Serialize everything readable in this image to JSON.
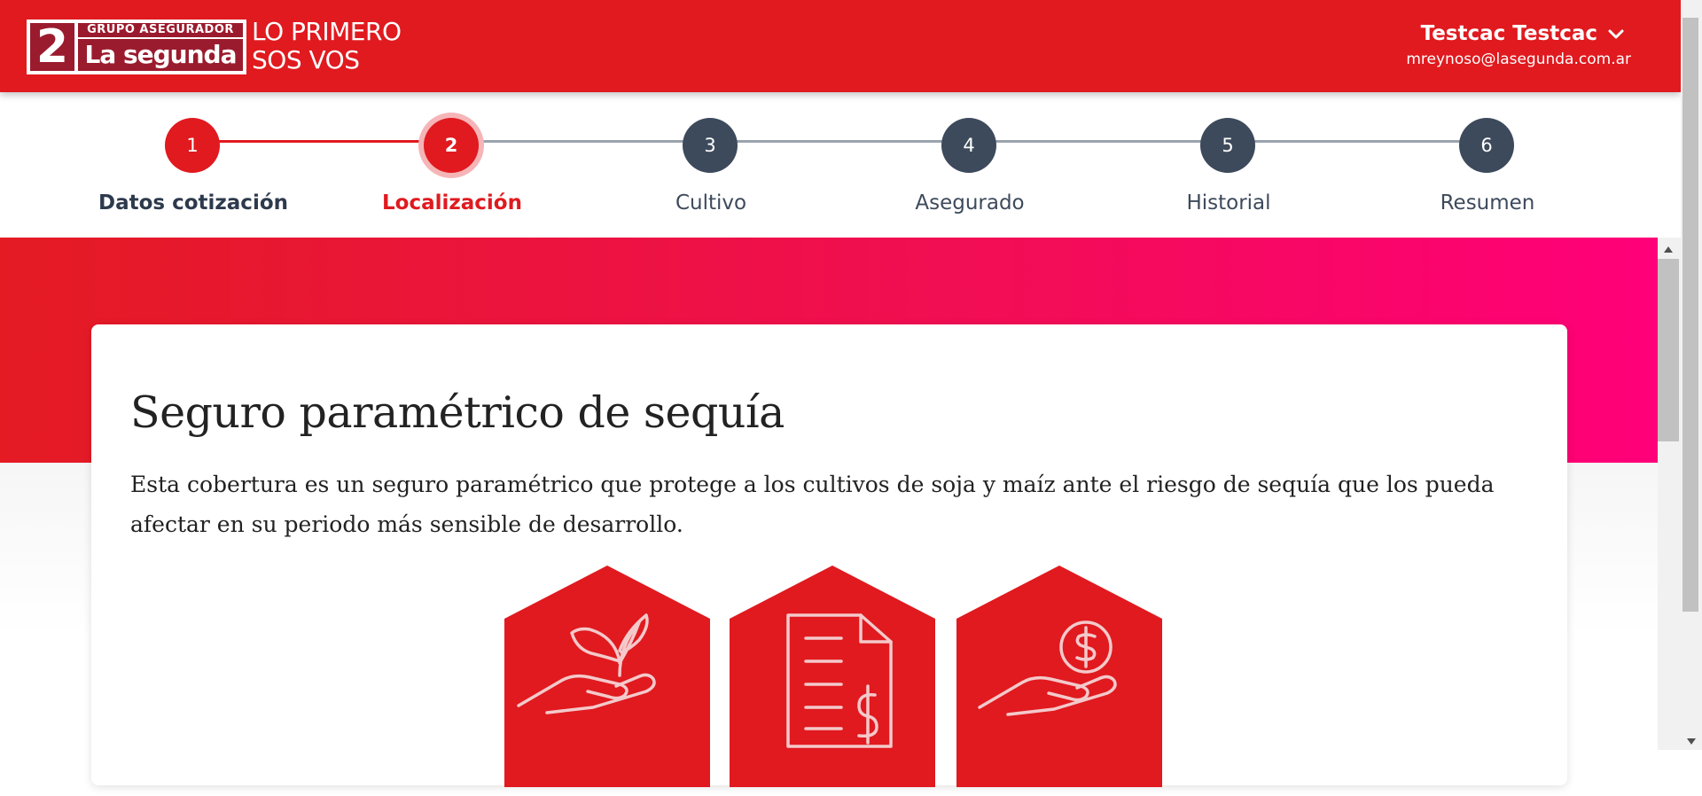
{
  "header": {
    "logo": {
      "mark": "2",
      "top_text": "GRUPO ASEGURADOR",
      "brand_text": "La segunda"
    },
    "tagline_line1": "LO PRIMERO",
    "tagline_line2": "SOS VOS",
    "user": {
      "name": "Testcac Testcac",
      "email": "mreynoso@lasegunda.com.ar",
      "menu_icon": "chevron-down-icon"
    }
  },
  "stepper": {
    "steps": [
      {
        "number": "1",
        "label": "Datos cotización",
        "state": "done"
      },
      {
        "number": "2",
        "label": "Localización",
        "state": "active"
      },
      {
        "number": "3",
        "label": "Cultivo",
        "state": "pending"
      },
      {
        "number": "4",
        "label": "Asegurado",
        "state": "pending"
      },
      {
        "number": "5",
        "label": "Historial",
        "state": "pending"
      },
      {
        "number": "6",
        "label": "Resumen",
        "state": "pending"
      }
    ]
  },
  "content": {
    "title": "Seguro paramétrico de sequía",
    "description": "Esta cobertura es un seguro paramétrico que protege a los cultivos de soja y maíz ante el riesgo de sequía que los pueda afectar en su periodo más sensible de desarrollo.",
    "icons": [
      "plant-in-hand-icon",
      "invoice-document-icon",
      "money-in-hand-icon"
    ]
  },
  "colors": {
    "brand_red": "#e01a1f",
    "brand_dark_red": "#9b1b2e",
    "hero_gradient_end": "#ff0079",
    "step_pending": "#3d4a5c",
    "step_line_pending": "#9aa3ad",
    "active_ring": "#f5b5b7"
  }
}
